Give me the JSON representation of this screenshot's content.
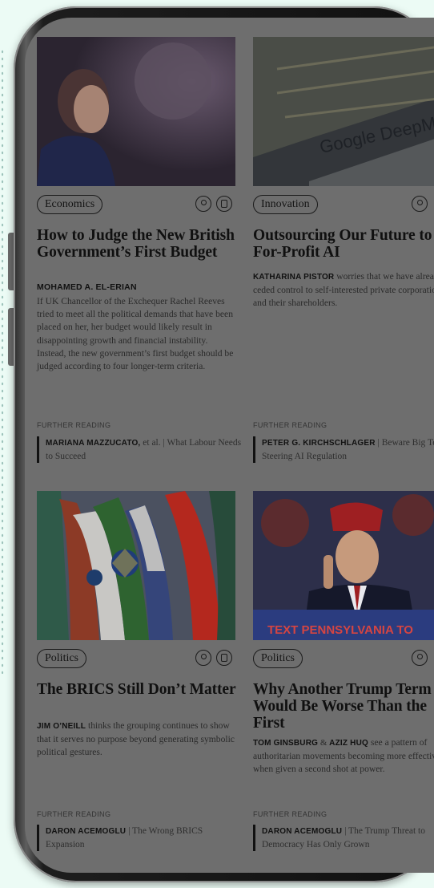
{
  "articles": [
    {
      "tag": "Economics",
      "title": "How to Judge the New British Government’s First Budget",
      "author": "MOHAMED A. EL-ERIAN",
      "dek": "If UK Chancellor of the Exchequer Rachel Reeves tried to meet all the political demands that have been placed on her, her budget would likely result in disappointing growth and financial instability. Instead, the new government’s first budget should be judged according to four longer-term criteria.",
      "further_reading_label": "FURTHER READING",
      "further_author": "MARIANA MAZZUCATO,",
      "further_extra": " et al. | What Labour Needs to Succeed"
    },
    {
      "tag": "Innovation",
      "title": "Outsourcing Our Future to For-Profit AI",
      "author": "KATHARINA PISTOR",
      "dek": " worries that we have already ceded control to self-interested private corporations and their shareholders.",
      "further_reading_label": "FURTHER READING",
      "further_author": "PETER G. KIRCHSCHLAGER",
      "further_extra": " | Beware Big Tech Steering AI Regulation",
      "image_text": "Google DeepMind"
    },
    {
      "tag": "Politics",
      "title": "The BRICS Still Don’t Matter",
      "author": "JIM O’NEILL",
      "dek": " thinks the grouping continues to show that it serves no purpose beyond generating symbolic political gestures.",
      "further_reading_label": "FURTHER READING",
      "further_author": "DARON ACEMOGLU",
      "further_extra": " | The Wrong BRICS Expansion"
    },
    {
      "tag": "Politics",
      "title": "Why Another Trump Term Would Be Worse Than the First",
      "author": "TOM GINSBURG",
      "author2": "AZIZ HUQ",
      "dek": " see a pattern of authoritarian movements becoming more effective when given a second shot at power.",
      "further_reading_label": "FURTHER READING",
      "further_author": "DARON ACEMOGLU",
      "further_extra": " | The Trump Threat to Democracy Has Only Grown",
      "image_text": "TEXT PENNSYLVANIA TO"
    }
  ],
  "icons": [
    "clock-icon",
    "bookmark-icon"
  ],
  "colors": {
    "background": "#ecfbf5",
    "screen_dim": "#6e6e6e",
    "text": "#101010"
  }
}
